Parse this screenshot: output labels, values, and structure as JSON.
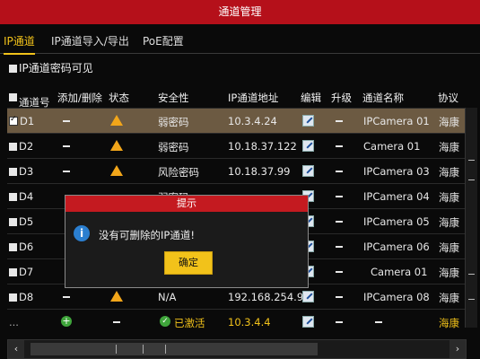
{
  "window": {
    "title": "通道管理"
  },
  "tabs": [
    {
      "label": "IP通道"
    },
    {
      "label": "IP通道导入/导出"
    },
    {
      "label": "PoE配置"
    }
  ],
  "password_visible": {
    "label": "IP通道密码可见"
  },
  "table": {
    "headers": {
      "channel": "通道号",
      "add_del": "添加/删除",
      "status": "状态",
      "security": "安全性",
      "ip": "IP通道地址",
      "edit": "编辑",
      "upgrade": "升级",
      "name": "通道名称",
      "protocol": "协议"
    },
    "rows": [
      {
        "channel": "D1",
        "security": "弱密码",
        "ip": "10.3.4.24",
        "name": "IPCamera 01",
        "protocol": "海康"
      },
      {
        "channel": "D2",
        "security": "弱密码",
        "ip": "10.18.37.122",
        "name": "Camera 01",
        "protocol": "海康"
      },
      {
        "channel": "D3",
        "security": "风险密码",
        "ip": "10.18.37.99",
        "name": "IPCamera 03",
        "protocol": "海康"
      },
      {
        "channel": "D4",
        "security": "弱密码",
        "ip": "",
        "name": "IPCamera 04",
        "protocol": "海康"
      },
      {
        "channel": "D5",
        "security": "",
        "ip": "",
        "name": "IPCamera 05",
        "protocol": "海康"
      },
      {
        "channel": "D6",
        "security": "",
        "ip": "",
        "name": "IPCamera 06",
        "protocol": "海康"
      },
      {
        "channel": "D7",
        "security": "",
        "ip": "",
        "name": "Camera 01",
        "protocol": "海康"
      },
      {
        "channel": "D8",
        "security": "N/A",
        "ip": "192.168.254.9",
        "name": "IPCamera 08",
        "protocol": "海康"
      },
      {
        "channel": "...",
        "security": "已激活",
        "ip": "10.3.4.4",
        "name": "",
        "protocol": "海康"
      }
    ]
  },
  "dialog": {
    "title": "提示",
    "message": "没有可删除的IP通道!",
    "ok_label": "确定"
  },
  "colors": {
    "titlebar": "#b5101a",
    "accent": "#f2c21a",
    "selected_row": "#6c5a42",
    "warning": "#f2a61a"
  }
}
